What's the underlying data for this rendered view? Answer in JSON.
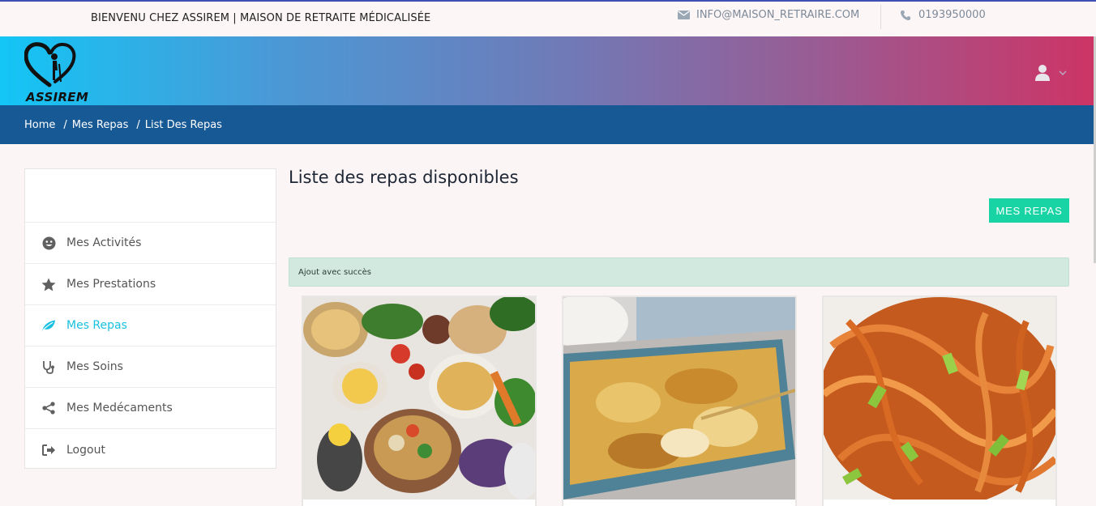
{
  "topbar": {
    "welcome": "BIENVENU CHEZ ASSIREM | MAISON DE RETRAITE MÉDICALISÉE",
    "email": "INFO@MAISON_RETRAIRE.COM",
    "phone": "0193950000"
  },
  "brand": {
    "name": "ASSIREM"
  },
  "breadcrumb": {
    "items": [
      "Home",
      "Mes Repas",
      "List Des Repas"
    ]
  },
  "sidebar": {
    "items": [
      {
        "label": "Mes Activités",
        "icon": "smile-icon"
      },
      {
        "label": "Mes Prestations",
        "icon": "star-icon"
      },
      {
        "label": "Mes Repas",
        "icon": "leaf-icon",
        "active": true
      },
      {
        "label": "Mes Soins",
        "icon": "stethoscope-icon"
      },
      {
        "label": "Mes Medécaments",
        "icon": "share-icon"
      },
      {
        "label": "Logout",
        "icon": "logout-icon"
      }
    ]
  },
  "main": {
    "title": "Liste des repas disponibles",
    "button_label": "MES REPAS",
    "alert_text": "Ajout avec succès"
  },
  "colors": {
    "accent": "#19c0e0",
    "button": "#18d4a4",
    "breadcrumb_bg": "#175995"
  }
}
